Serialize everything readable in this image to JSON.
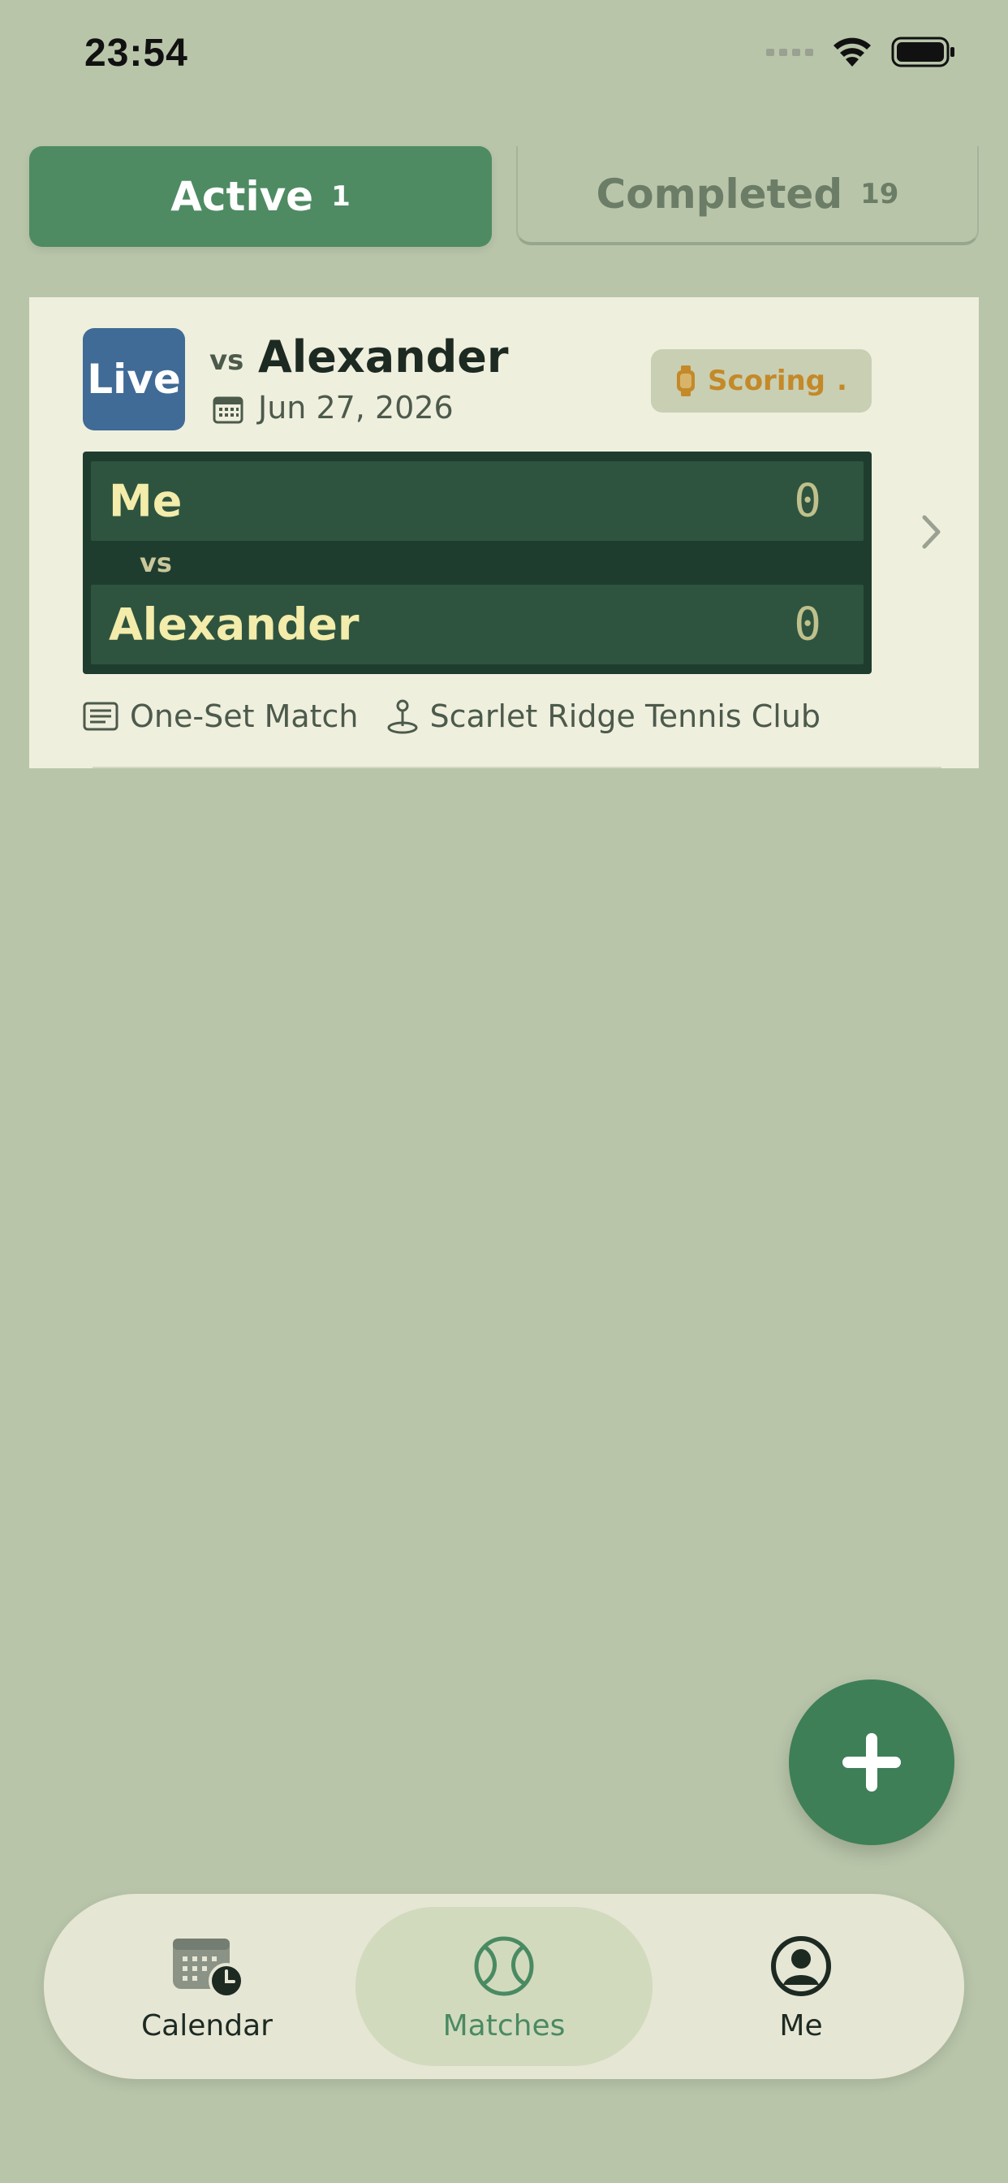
{
  "status_bar": {
    "time": "23:54"
  },
  "tabs": [
    {
      "label": "Active",
      "count": "1",
      "selected": true
    },
    {
      "label": "Completed",
      "count": "19",
      "selected": false
    }
  ],
  "match_card": {
    "status_badge": "Live",
    "vs_prefix": "vs",
    "opponent": "Alexander",
    "date": "Jun 27, 2026",
    "scoring_badge": {
      "label": "Scoring",
      "indicator": "."
    },
    "scoreboard": {
      "separator": "vs",
      "rows": [
        {
          "name": "Me",
          "score": "0"
        },
        {
          "name": "Alexander",
          "score": "0"
        }
      ]
    },
    "format": "One-Set Match",
    "venue": "Scarlet Ridge Tennis Club"
  },
  "bottom_nav": [
    {
      "label": "Calendar",
      "icon": "calendar-clock-icon",
      "selected": false
    },
    {
      "label": "Matches",
      "icon": "tennis-ball-icon",
      "selected": true
    },
    {
      "label": "Me",
      "icon": "person-circle-icon",
      "selected": false
    }
  ],
  "colors": {
    "background": "#b8c5a9",
    "accent_green": "#4e8b63",
    "live_blue": "#3f6b96",
    "scoring_orange": "#c48928",
    "scoreboard_dark": "#1f3d2f",
    "score_text": "#f3ecaa",
    "fab": "#3e7f58"
  }
}
